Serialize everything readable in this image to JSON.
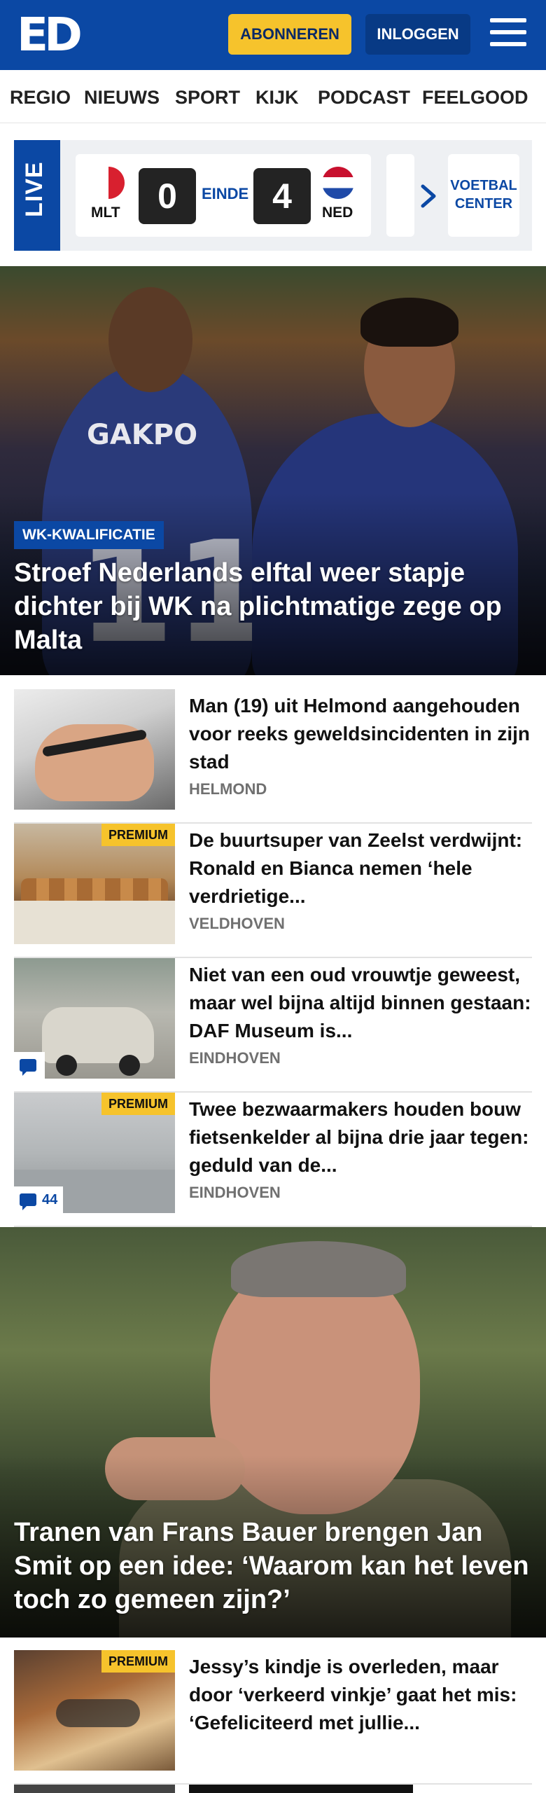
{
  "header": {
    "logo": "ED",
    "subscribe_label": "ABONNEREN",
    "login_label": "INLOGGEN"
  },
  "nav": {
    "items": [
      {
        "label": "REGIO"
      },
      {
        "label": "NIEUWS"
      },
      {
        "label": "SPORT"
      },
      {
        "label": "KIJK"
      },
      {
        "label": "PODCAST"
      },
      {
        "label": "FEELGOOD"
      }
    ]
  },
  "live": {
    "label": "LIVE",
    "home_team": "MLT",
    "away_team": "NED",
    "home_score": "0",
    "away_score": "4",
    "status": "EINDE",
    "voetbal_center": "VOETBAL CENTER"
  },
  "hero1": {
    "category": "WK-KWALIFICATIE",
    "title": "Stroef Nederlands elftal weer stapje dichter bij WK na plichtmatige zege op Malta",
    "shirt_name": "GAKPO",
    "shirt_number": "11"
  },
  "articles": [
    {
      "title": "Man (19) uit Helmond aangehou­den voor reeks geweldsinciden­ten in zijn stad",
      "region": "HELMOND"
    },
    {
      "title": "De buurtsuper van Zeelst verdwijnt: Ronald en Bianca nemen ‘hele verdrietige...",
      "region": "VELDHOVEN",
      "premium": "PREMIUM"
    },
    {
      "title": "Niet van een oud vrouwtje geweest, maar wel bijna altijd binnen gestaan: DAF Museum is...",
      "region": "EINDHOVEN"
    },
    {
      "title": "Twee bezwaarmakers houden bouw fietsenkelder al bijna drie jaar tegen: geduld van de...",
      "region": "EINDHOVEN",
      "premium": "PREMIUM",
      "comments": "44"
    }
  ],
  "hero2": {
    "title": "Tranen van Frans Bauer brengen Jan Smit op een idee: ‘Waarom kan het leven toch zo gemeen zijn?’"
  },
  "article5": {
    "title": "Jessy’s kindje is overleden, maar door ‘verkeerd vinkje’ gaat het mis: ‘Gefeliciteerd met jullie...",
    "premium": "PREMIUM"
  },
  "colors": {
    "brand_blue": "#0b48a4",
    "accent_yellow": "#f6c32c"
  }
}
